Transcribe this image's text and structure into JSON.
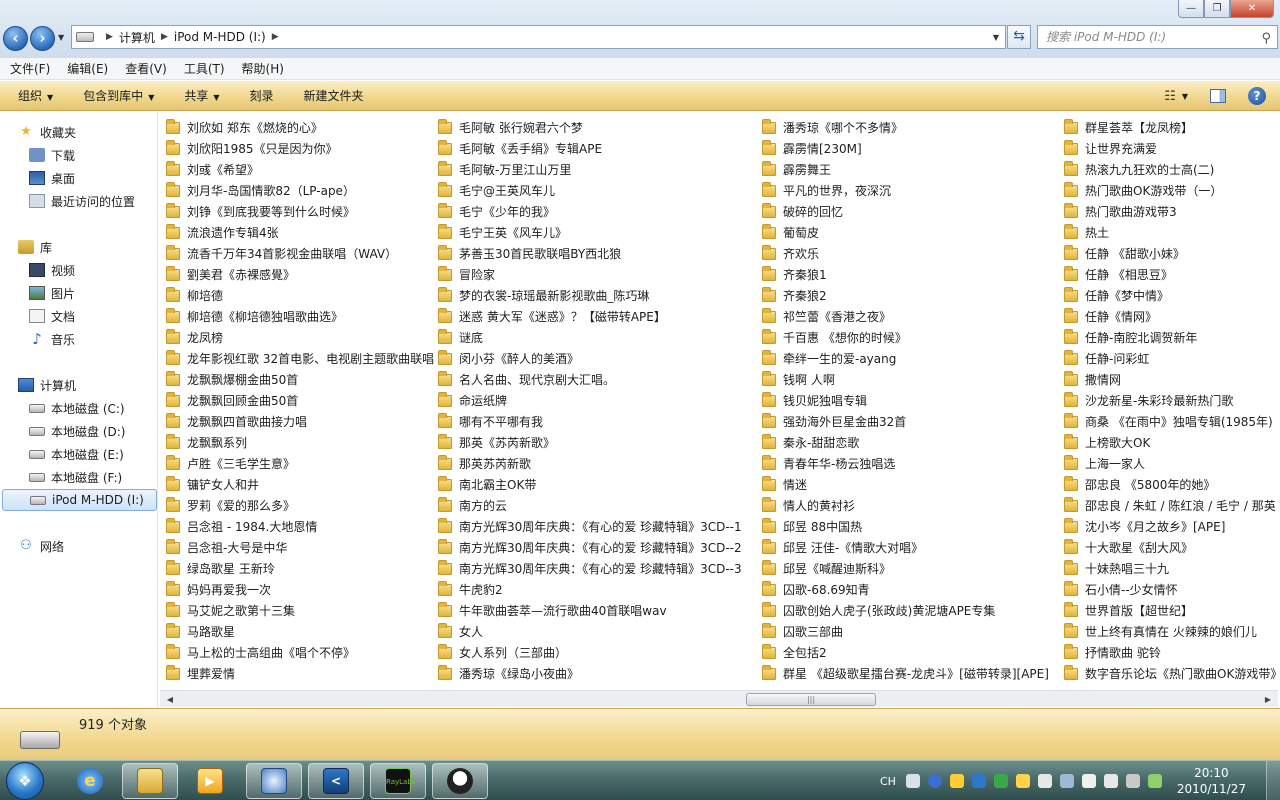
{
  "window": {
    "minimize_label": "—",
    "maximize_label": "❐",
    "close_label": "✕"
  },
  "address": {
    "crumbs": [
      "计算机",
      "iPod M-HDD (I:)"
    ],
    "search_placeholder": "搜索 iPod M-HDD (I:)"
  },
  "menu": [
    "文件(F)",
    "编辑(E)",
    "查看(V)",
    "工具(T)",
    "帮助(H)"
  ],
  "toolbar": {
    "organize": "组织",
    "include_library": "包含到库中",
    "share": "共享",
    "burn": "刻录",
    "new_folder": "新建文件夹"
  },
  "nav": {
    "favorites": "收藏夹",
    "downloads": "下载",
    "desktop": "桌面",
    "recent": "最近访问的位置",
    "libraries": "库",
    "videos": "视频",
    "pictures": "图片",
    "documents": "文档",
    "music": "音乐",
    "computer": "计算机",
    "drive_c": "本地磁盘 (C:)",
    "drive_d": "本地磁盘 (D:)",
    "drive_e": "本地磁盘 (E:)",
    "drive_f": "本地磁盘 (F:)",
    "drive_i": "iPod M-HDD (I:)",
    "network": "网络"
  },
  "folders": [
    [
      "刘欣如 郑东《燃烧的心》",
      "刘欣阳1985《只是因为你》",
      "刘彧《希望》",
      "刘月华-岛国情歌82（LP-ape）",
      "刘铮《到底我要等到什么时候》",
      "流浪遗作专辑4张",
      "流香千万年34首影视金曲联唱（WAV）",
      "劉美君《赤裸感覺》",
      "柳培德",
      "柳培德《柳培德独唱歌曲选》",
      "龙凤榜",
      "龙年影视红歌 32首电影、电视剧主题歌曲联唱",
      "龙飘飘爆棚金曲50首",
      "龙飘飘回顾金曲50首",
      "龙飘飘四首歌曲接力唱",
      "龙飘飘系列",
      "卢胜《三毛学生意》",
      "镛铲女人和井",
      "罗莉《爱的那么多》",
      "吕念祖 - 1984.大地恩情",
      "吕念祖-大号是中华",
      "绿岛歌星 王新玲",
      "妈妈再爱我一次",
      "马艾妮之歌第十三集",
      "马路歌星",
      "马上松的士高组曲《唱个不停》",
      "埋葬爱情"
    ],
    [
      "毛阿敏 张行婉君六个梦",
      "毛阿敏《丢手绢》专辑APE",
      "毛阿敏-万里江山万里",
      "毛宁@王英风车儿",
      "毛宁《少年的我》",
      "毛宁王英《风车儿》",
      "茅善玉30首民歌联唱BY西北狼",
      "冒险家",
      "梦的衣裳-琼瑶最新影视歌曲_陈巧琳",
      "迷惑 黄大军《迷惑》？【磁带转APE】",
      "谜底",
      "闵小芬《醉人的美酒》",
      "名人名曲、现代京剧大汇唱。",
      "命运纸牌",
      "哪有不平哪有我",
      "那英《苏芮新歌》",
      "那英苏芮新歌",
      "南北霸主OK带",
      "南方的云",
      "南方光辉30周年庆典：《有心的爱 珍藏特辑》3CD--1",
      "南方光辉30周年庆典：《有心的爱 珍藏特辑》3CD--2",
      "南方光辉30周年庆典：《有心的爱 珍藏特辑》3CD--3",
      "牛虎豹2",
      "牛年歌曲荟萃—流行歌曲40首联唱wav",
      "女人",
      "女人系列（三部曲）",
      "潘秀琼《绿岛小夜曲》"
    ],
    [
      "潘秀琼《哪个不多情》",
      "霹雳情[230M]",
      "霹雳舞王",
      "平凡的世界，夜深沉",
      "破碎的回忆",
      "葡萄皮",
      "齐欢乐",
      "齐秦狼1",
      "齐秦狼2",
      "祁竺蕾《香港之夜》",
      "千百惠 《想你的时候》",
      "牵绊一生的爱-ayang",
      "钱啊 人啊",
      "钱贝妮独唱专辑",
      "强劲海外巨星金曲32首",
      "秦永-甜甜恋歌",
      "青春年华-杨云独唱选",
      "情迷",
      "情人的黄衬衫",
      "邱昱 88中国热",
      "邱昱 汪佳-《情歌大对唱》",
      "邱昱《喊醒迪斯科》",
      "囚歌-68.69知青",
      "囚歌创始人虎子(张政歧)黄泥塘APE专集",
      "囚歌三部曲",
      "全包括2",
      "群星 《超级歌星擂台赛-龙虎斗》[磁带转录][APE]"
    ],
    [
      "群星荟萃【龙凤榜】",
      "让世界充满爱",
      "热滚九九狂欢的士高(二)",
      "热门歌曲OK游戏带（一）",
      "热门歌曲游戏带3",
      "热土",
      "任静 《甜歌小妹》",
      "任静 《相思豆》",
      "任静《梦中情》",
      "任静《情网》",
      "任静-南腔北调贺新年",
      "任静-问彩虹",
      "撒情网",
      "沙龙新星-朱彩玲最新热门歌",
      "商桑 《在雨中》独唱专辑(1985年)",
      "上榜歌大OK",
      "上海一家人",
      "邵忠良 《5800年的她》",
      "邵忠良 / 朱虹 / 陈红浪 / 毛宁 / 那英 /",
      "沈小岑《月之故乡》[APE]",
      "十大歌星《刮大风》",
      "十妹熱唱三十九",
      "石小倩--少女情怀",
      "世界首版【超世纪】",
      "世上终有真情在 火辣辣的娘们儿",
      "抒情歌曲 驼铃",
      "数字音乐论坛《热门歌曲OK游戏带》"
    ]
  ],
  "status": {
    "count": "919 个对象"
  },
  "taskbar": {
    "ray_label": "RayLabs",
    "tray_lang": "CH",
    "time": "20:10",
    "date": "2010/11/27"
  },
  "icons": {
    "back": "back-arrow-icon",
    "forward": "forward-arrow-icon",
    "refresh": "refresh-icon",
    "search": "search-icon",
    "folder": "folder-icon"
  }
}
